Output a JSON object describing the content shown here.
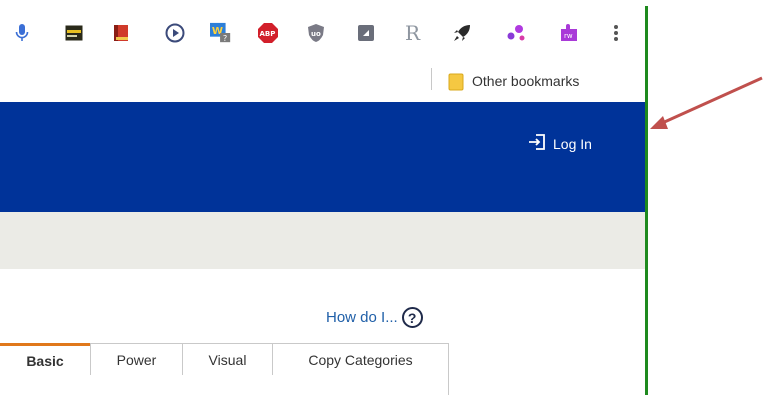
{
  "extensions": [
    {
      "icon": "microphone-icon",
      "color": "#3b6fd6"
    },
    {
      "icon": "window-icon",
      "color": "#5a5a2a"
    },
    {
      "icon": "book-icon",
      "color": "#d03a2a"
    },
    {
      "icon": "play-circle-icon",
      "color": "#3b4a7a"
    },
    {
      "icon": "w-badge-icon",
      "color": "#2d7fd8"
    },
    {
      "icon": "adblock-icon",
      "color": "#d21f2a",
      "text": "ABP"
    },
    {
      "icon": "ublock-shield-icon",
      "color": "#7a7a86",
      "text": "uo"
    },
    {
      "icon": "square-icon",
      "color": "#6a6e7a"
    },
    {
      "icon": "r-icon",
      "color": "#8e96a0",
      "text": "R"
    },
    {
      "icon": "rocket-icon",
      "color": "#2a2a2a"
    },
    {
      "icon": "dots-cluster-icon",
      "color": "#9a3ad8"
    },
    {
      "icon": "puzzle-rw-icon",
      "color": "#a93ad8",
      "text": "rw"
    },
    {
      "icon": "more-menu-icon",
      "color": "#555555"
    }
  ],
  "bookmarks": {
    "other_label": "Other bookmarks"
  },
  "header": {
    "login_label": "Log In",
    "background": "#003399"
  },
  "help": {
    "label": "How do I...",
    "symbol": "?"
  },
  "tabs": [
    {
      "label": "Basic",
      "active": true
    },
    {
      "label": "Power",
      "active": false
    },
    {
      "label": "Visual",
      "active": false
    },
    {
      "label": "Copy Categories",
      "active": false
    }
  ],
  "colors": {
    "accent_tab": "#e0781b",
    "link": "#1f5fa8",
    "annotation_arrow": "#c0504d",
    "window_edge": "#1e8a1e"
  }
}
